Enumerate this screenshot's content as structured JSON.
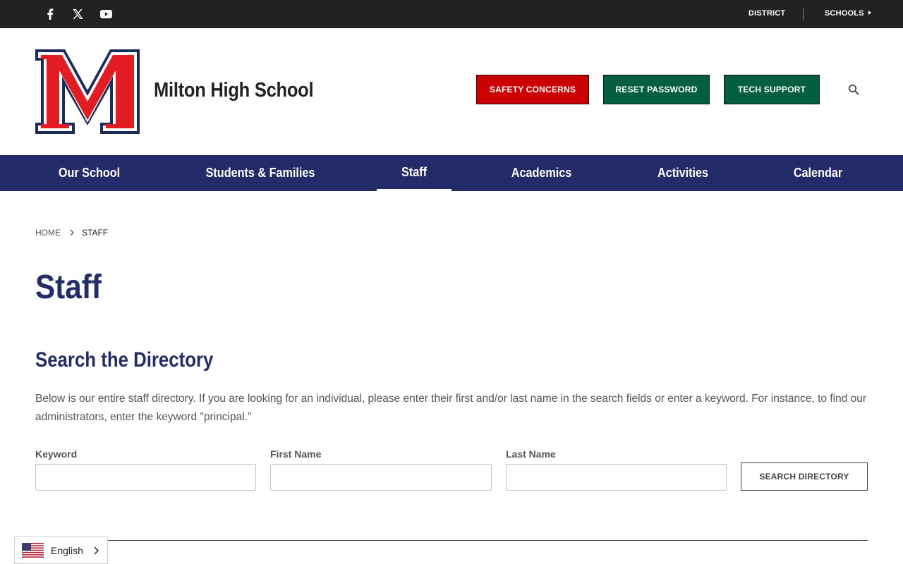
{
  "topbar": {
    "social_icons": [
      "facebook-icon",
      "x-twitter-icon",
      "youtube-icon"
    ],
    "links": {
      "district": "DISTRICT",
      "schools": "SCHOOLS"
    }
  },
  "header": {
    "logo_letter": "M",
    "school_name": "Milton High School",
    "buttons": {
      "safety": "SAFETY CONCERNS",
      "reset": "RESET PASSWORD",
      "tech": "TECH SUPPORT"
    },
    "search_icon": "search-icon"
  },
  "nav": {
    "items": [
      {
        "label": "Our School"
      },
      {
        "label": "Students & Families"
      },
      {
        "label": "Staff",
        "active": true
      },
      {
        "label": "Academics"
      },
      {
        "label": "Activities"
      },
      {
        "label": "Calendar"
      }
    ]
  },
  "breadcrumb": {
    "home": "HOME",
    "current": "STAFF"
  },
  "page": {
    "title": "Staff",
    "section_title": "Search the Directory",
    "intro": "Below is our entire staff directory. If you are looking for an individual, please enter their first and/or last name in the search fields or enter a keyword. For instance, to find our administrators, enter the keyword \"principal.\""
  },
  "form": {
    "keyword_label": "Keyword",
    "keyword_value": "",
    "first_name_label": "First Name",
    "first_name_value": "",
    "last_name_label": "Last Name",
    "last_name_value": "",
    "search_button": "SEARCH DIRECTORY"
  },
  "language": {
    "selected": "English",
    "flag_icon": "us-flag-icon"
  },
  "colors": {
    "nav_blue": "#232b68",
    "safety_red": "#cc0000",
    "action_green": "#035f3f",
    "logo_red": "#e31b23",
    "topbar_dark": "#222222"
  }
}
